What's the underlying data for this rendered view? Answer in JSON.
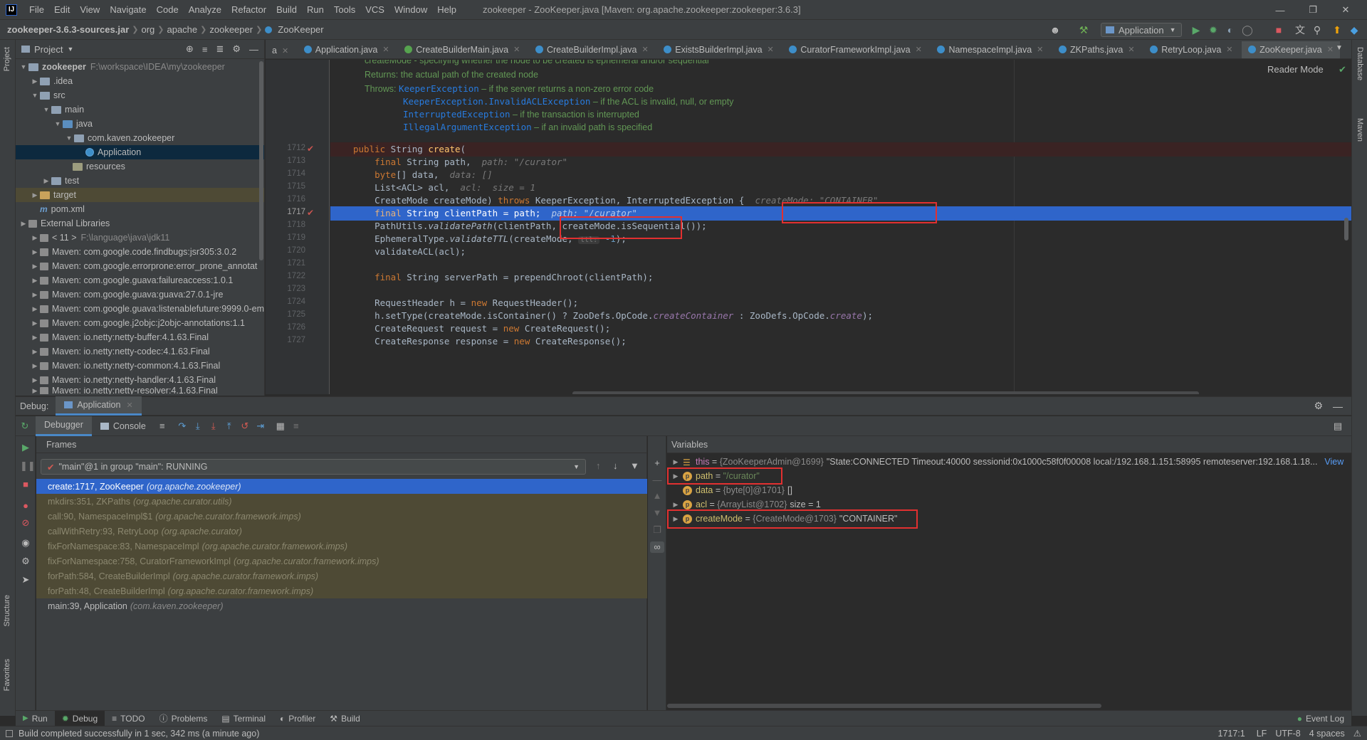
{
  "menubar": {
    "logo": "IJ",
    "items": [
      "File",
      "Edit",
      "View",
      "Navigate",
      "Code",
      "Analyze",
      "Refactor",
      "Build",
      "Run",
      "Tools",
      "VCS",
      "Window",
      "Help"
    ],
    "title": "zookeeper - ZooKeeper.java [Maven: org.apache.zookeeper:zookeeper:3.6.3]"
  },
  "navbar": {
    "crumbs": [
      "zookeeper-3.6.3-sources.jar",
      "org",
      "apache",
      "zookeeper",
      "ZooKeeper"
    ],
    "run_config": "Application"
  },
  "left_stripe": {
    "project": "Project",
    "structure": "Structure",
    "favorites": "Favorites"
  },
  "right_stripe": {
    "database": "Database",
    "maven": "Maven"
  },
  "project": {
    "header": "Project",
    "root_name": "zookeeper",
    "root_path": "F:\\workspace\\IDEA\\my\\zookeeper",
    "tree": [
      {
        "label": ".idea"
      },
      {
        "label": "src"
      },
      {
        "label": "main"
      },
      {
        "label": "java"
      },
      {
        "label": "com.kaven.zookeeper"
      },
      {
        "label": "Application"
      },
      {
        "label": "resources"
      },
      {
        "label": "test"
      },
      {
        "label": "target"
      },
      {
        "label": "pom.xml"
      },
      {
        "label": "External Libraries"
      },
      {
        "label": "< 11 >",
        "extra": "F:\\language\\java\\jdk11"
      },
      {
        "label": "Maven: com.google.code.findbugs:jsr305:3.0.2"
      },
      {
        "label": "Maven: com.google.errorprone:error_prone_annotat"
      },
      {
        "label": "Maven: com.google.guava:failureaccess:1.0.1"
      },
      {
        "label": "Maven: com.google.guava:guava:27.0.1-jre"
      },
      {
        "label": "Maven: com.google.guava:listenablefuture:9999.0-em"
      },
      {
        "label": "Maven: com.google.j2objc:j2objc-annotations:1.1"
      },
      {
        "label": "Maven: io.netty:netty-buffer:4.1.63.Final"
      },
      {
        "label": "Maven: io.netty:netty-codec:4.1.63.Final"
      },
      {
        "label": "Maven: io.netty:netty-common:4.1.63.Final"
      },
      {
        "label": "Maven: io.netty:netty-handler:4.1.63.Final"
      },
      {
        "label": "Maven: io.netty:netty-resolver:4.1.63.Final"
      }
    ]
  },
  "tabs": [
    {
      "label": "a"
    },
    {
      "label": "Application.java"
    },
    {
      "label": "CreateBuilderMain.java"
    },
    {
      "label": "CreateBuilderImpl.java"
    },
    {
      "label": "ExistsBuilderImpl.java"
    },
    {
      "label": "CuratorFrameworkImpl.java"
    },
    {
      "label": "NamespaceImpl.java"
    },
    {
      "label": "ZKPaths.java"
    },
    {
      "label": "RetryLoop.java"
    },
    {
      "label": "ZooKeeper.java"
    }
  ],
  "editor": {
    "reader_mode": "Reader Mode",
    "doc": {
      "line0": "createMode - specifying whether the node to be created is ephemeral and/or sequential",
      "returns_label": "Returns:",
      "returns_text": "the actual path of the created node",
      "throws_label": "Throws:",
      "throws": [
        {
          "ex": "KeeperException",
          "text": " – if the server returns a non-zero error code"
        },
        {
          "ex": "KeeperException.InvalidACLException",
          "text": " – if the ACL is invalid, null, or empty"
        },
        {
          "ex": "InterruptedException",
          "text": " – if the transaction is interrupted"
        },
        {
          "ex": "IllegalArgumentException",
          "text": " – if an invalid path is specified"
        }
      ]
    },
    "line_numbers": [
      "1712",
      "1713",
      "1714",
      "1715",
      "1716",
      "1717",
      "1718",
      "1719",
      "1720",
      "1721",
      "1722",
      "1723",
      "1724",
      "1725",
      "1726",
      "1727"
    ],
    "hints": {
      "path": "path: \"/curator\"",
      "data": "data: []",
      "acl": "acl:  size = 1",
      "createMode": "createMode: \"CONTAINER\"",
      "path2": "path: \"/curator\"",
      "ttl": "ttl:"
    }
  },
  "debug": {
    "label": "Debug:",
    "session": "Application",
    "tabs": {
      "debugger": "Debugger",
      "console": "Console"
    },
    "frames_header": "Frames",
    "thread": "\"main\"@1 in group \"main\": RUNNING",
    "frames": [
      {
        "method": "create:1717, ZooKeeper",
        "pkg": "(org.apache.zookeeper)",
        "kind": "sel"
      },
      {
        "method": "mkdirs:351, ZKPaths",
        "pkg": "(org.apache.curator.utils)",
        "kind": "lib"
      },
      {
        "method": "call:90, NamespaceImpl$1",
        "pkg": "(org.apache.curator.framework.imps)",
        "kind": "lib"
      },
      {
        "method": "callWithRetry:93, RetryLoop",
        "pkg": "(org.apache.curator)",
        "kind": "lib"
      },
      {
        "method": "fixForNamespace:83, NamespaceImpl",
        "pkg": "(org.apache.curator.framework.imps)",
        "kind": "lib"
      },
      {
        "method": "fixForNamespace:758, CuratorFrameworkImpl",
        "pkg": "(org.apache.curator.framework.imps)",
        "kind": "lib"
      },
      {
        "method": "forPath:584, CreateBuilderImpl",
        "pkg": "(org.apache.curator.framework.imps)",
        "kind": "lib"
      },
      {
        "method": "forPath:48, CreateBuilderImpl",
        "pkg": "(org.apache.curator.framework.imps)",
        "kind": "lib"
      },
      {
        "method": "main:39, Application",
        "pkg": "(com.kaven.zookeeper)",
        "kind": "norm"
      }
    ],
    "vars_header": "Variables",
    "vars": [
      {
        "name": "this",
        "ref": "{ZooKeeperAdmin@1699}",
        "value": "\"State:CONNECTED Timeout:40000 sessionid:0x1000c58f0f00008 local:/192.168.1.151:58995 remoteserver:192.168.1.18...",
        "link": "View"
      },
      {
        "name": "path",
        "value": "\"/curator\""
      },
      {
        "name": "data",
        "ref": "{byte[0]@1701}",
        "value": "[]"
      },
      {
        "name": "acl",
        "ref": "{ArrayList@1702}",
        "value": "size = 1"
      },
      {
        "name": "createMode",
        "ref": "{CreateMode@1703}",
        "value": "\"CONTAINER\""
      }
    ]
  },
  "toolwindows": [
    {
      "label": "Run"
    },
    {
      "label": "Debug"
    },
    {
      "label": "TODO"
    },
    {
      "label": "Problems"
    },
    {
      "label": "Terminal"
    },
    {
      "label": "Profiler"
    },
    {
      "label": "Build"
    }
  ],
  "event_log": "Event Log",
  "status": {
    "message": "Build completed successfully in 1 sec, 342 ms (a minute ago)",
    "position": "1717:1",
    "line_sep": "LF",
    "encoding": "UTF-8",
    "indent": "4 spaces"
  }
}
